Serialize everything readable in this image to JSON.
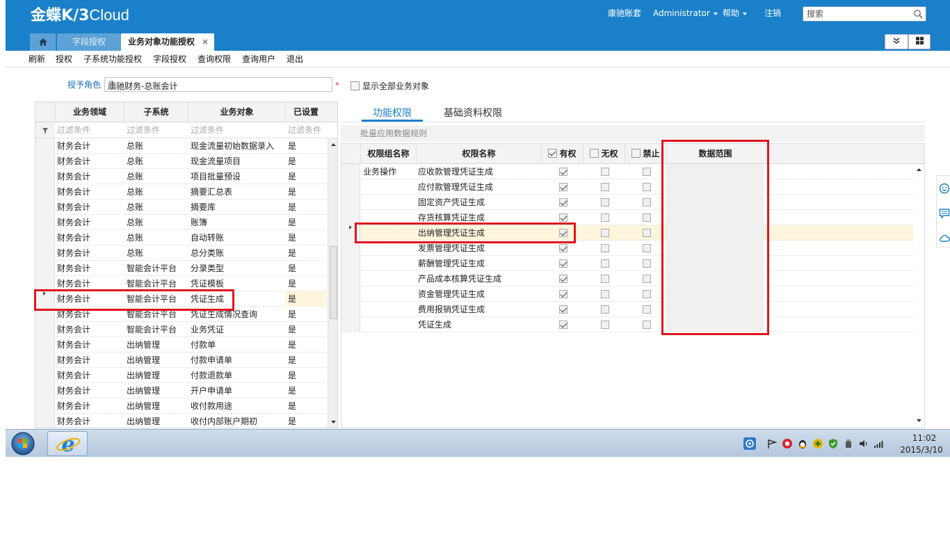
{
  "header": {
    "logo_main": "金蝶",
    "logo_k3": "K/3",
    "logo_cloud": "Cloud",
    "account": "康驰账套",
    "user": "Administrator",
    "help": "帮助",
    "logout": "注销",
    "search_placeholder": "搜索"
  },
  "tabs": {
    "home_icon": "home-icon",
    "field_auth": "字段授权",
    "active": "业务对象功能授权",
    "close": "×"
  },
  "menu": [
    "刷新",
    "授权",
    "子系统功能授权",
    "字段授权",
    "查询权限",
    "查询用户",
    "退出"
  ],
  "role": {
    "label": "授予角色",
    "value": "康驰财务-总账会计",
    "required": "*",
    "show_all_label": "显示全部业务对象",
    "show_all_checked": false
  },
  "left_grid": {
    "columns": [
      "业务领域",
      "子系统",
      "业务对象",
      "已设置"
    ],
    "filter_placeholder": "过滤条件",
    "rows": [
      [
        "财务会计",
        "总账",
        "现金流量初始数据录入",
        "是"
      ],
      [
        "财务会计",
        "总账",
        "现金流量项目",
        "是"
      ],
      [
        "财务会计",
        "总账",
        "项目批量预设",
        "是"
      ],
      [
        "财务会计",
        "总账",
        "摘要汇总表",
        "是"
      ],
      [
        "财务会计",
        "总账",
        "摘要库",
        "是"
      ],
      [
        "财务会计",
        "总账",
        "账簿",
        "是"
      ],
      [
        "财务会计",
        "总账",
        "自动转账",
        "是"
      ],
      [
        "财务会计",
        "总账",
        "总分类账",
        "是"
      ],
      [
        "财务会计",
        "智能会计平台",
        "分录类型",
        "是"
      ],
      [
        "财务会计",
        "智能会计平台",
        "凭证模板",
        "是"
      ],
      [
        "财务会计",
        "智能会计平台",
        "凭证生成",
        "是"
      ],
      [
        "财务会计",
        "智能会计平台",
        "凭证生成情况查询",
        "是"
      ],
      [
        "财务会计",
        "智能会计平台",
        "业务凭证",
        "是"
      ],
      [
        "财务会计",
        "出纳管理",
        "付款单",
        "是"
      ],
      [
        "财务会计",
        "出纳管理",
        "付款申请单",
        "是"
      ],
      [
        "财务会计",
        "出纳管理",
        "付款退款单",
        "是"
      ],
      [
        "财务会计",
        "出纳管理",
        "开户申请单",
        "是"
      ],
      [
        "财务会计",
        "出纳管理",
        "收付款用途",
        "是"
      ],
      [
        "财务会计",
        "出纳管理",
        "收付内部账户期初",
        "是"
      ]
    ],
    "selected_index": 10
  },
  "right_panel": {
    "tabs": [
      "功能权限",
      "基础资料权限"
    ],
    "bulk_rule": "批量应用数据规则",
    "columns": {
      "group": "权限组名称",
      "name": "权限名称",
      "has": "有权",
      "none": "无权",
      "forbid": "禁止",
      "scope": "数据范围"
    },
    "header_has_checked": true,
    "header_none_checked": false,
    "header_forbid_checked": false,
    "group_name": "业务操作",
    "rows": [
      {
        "name": "应收款管理凭证生成",
        "has": true,
        "none": false,
        "forbid": false
      },
      {
        "name": "应付款管理凭证生成",
        "has": true,
        "none": false,
        "forbid": false
      },
      {
        "name": "固定资产凭证生成",
        "has": true,
        "none": false,
        "forbid": false
      },
      {
        "name": "存货核算凭证生成",
        "has": true,
        "none": false,
        "forbid": false
      },
      {
        "name": "出纳管理凭证生成",
        "has": true,
        "none": false,
        "forbid": false
      },
      {
        "name": "发票管理凭证生成",
        "has": true,
        "none": false,
        "forbid": false
      },
      {
        "name": "薪酬管理凭证生成",
        "has": true,
        "none": false,
        "forbid": false
      },
      {
        "name": "产品成本核算凭证生成",
        "has": true,
        "none": false,
        "forbid": false
      },
      {
        "name": "资金管理凭证生成",
        "has": true,
        "none": false,
        "forbid": false
      },
      {
        "name": "费用报销凭证生成",
        "has": true,
        "none": false,
        "forbid": false
      },
      {
        "name": "凭证生成",
        "has": true,
        "none": false,
        "forbid": false
      }
    ],
    "selected_index": 4
  },
  "side_icons": [
    "smiley-icon",
    "comment-icon",
    "cloud-icon"
  ],
  "taskbar": {
    "start_icon": "windows-start-icon",
    "pinned_icon": "internet-explorer-icon",
    "time": "11:02",
    "date": "2015/3/10",
    "tray_icons": [
      "network-icon",
      "flag-icon",
      "qq-icon",
      "qq-group-icon",
      "add-icon",
      "shield-icon",
      "usb-icon",
      "volume-icon",
      "signal-icon"
    ]
  },
  "colors": {
    "brand_blue": "#1a80c9",
    "highlight_red": "#e0141e",
    "selected_row": "#fdf5dc"
  }
}
